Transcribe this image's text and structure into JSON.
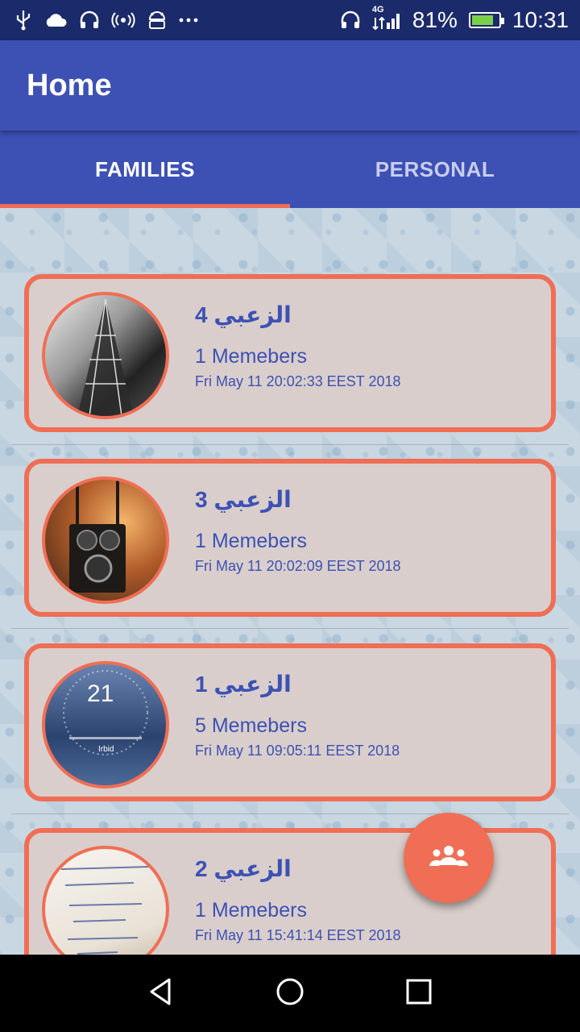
{
  "status_bar": {
    "left_icons": [
      "usb-icon",
      "cloud-icon",
      "headset-icon",
      "hotspot-icon",
      "android-debug-icon",
      "more-dots-icon"
    ],
    "network": "4G",
    "battery_percent": "81%",
    "battery_level": 0.81,
    "time": "10:31"
  },
  "app_bar": {
    "title": "Home"
  },
  "tabs": [
    {
      "label": "FAMILIES",
      "active": true
    },
    {
      "label": "PERSONAL",
      "active": false
    }
  ],
  "families": [
    {
      "name": "الزعبي 4",
      "members": "1 Memebers",
      "date": "Fri May 11 20:02:33 EEST 2018",
      "image": "eiffel-tower-photo"
    },
    {
      "name": "الزعبي 3",
      "members": "1 Memebers",
      "date": "Fri May 11 20:02:09 EEST 2018",
      "image": "vintage-camera-photo"
    },
    {
      "name": "الزعبي 1",
      "members": "5 Memebers",
      "date": "Fri May 11 09:05:11 EEST 2018",
      "image": "weather-screenshot-photo"
    },
    {
      "name": "الزعبي 2",
      "members": "1 Memebers",
      "date": "Fri May 11 15:41:14 EEST 2018",
      "image": "handwritten-note-photo"
    }
  ],
  "weather_photo": {
    "temperature": "21",
    "city": "Irbid"
  },
  "fab": {
    "icon": "group-icon"
  },
  "nav_bar": {
    "icons": [
      "back-icon",
      "home-icon",
      "recents-icon"
    ]
  },
  "colors": {
    "primary": "#3d51b5",
    "accent": "#f06e55",
    "card_bg": "#d9cecb"
  }
}
